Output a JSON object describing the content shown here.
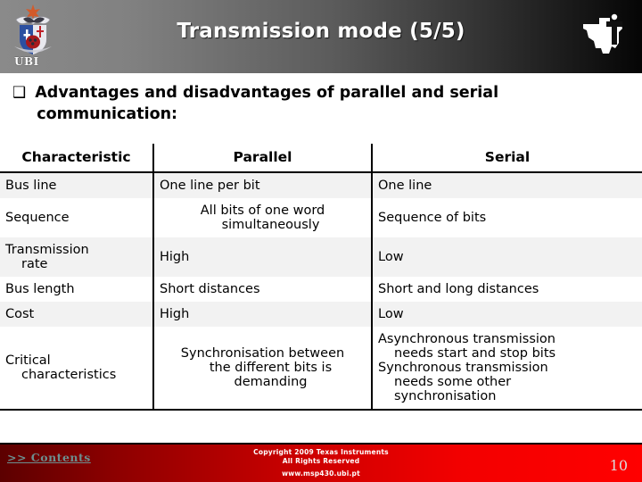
{
  "header": {
    "title": "Transmission mode (5/5)",
    "left_logo_label": "UBI",
    "right_logo_name": "ti-logo"
  },
  "bullet": {
    "glyph": "❑",
    "line1": "Advantages and disadvantages of parallel and serial",
    "line2": "communication:"
  },
  "table": {
    "columns": [
      "Characteristic",
      "Parallel",
      "Serial"
    ],
    "rows": [
      {
        "characteristic": "Bus line",
        "parallel": "One line per bit",
        "serial": "One line",
        "shaded": true
      },
      {
        "characteristic": "Sequence",
        "parallel_l1": "All bits of one word",
        "parallel_l2": "simultaneously",
        "serial": "Sequence of bits",
        "shaded": false
      },
      {
        "characteristic_l1": "Transmission",
        "characteristic_l2": "rate",
        "parallel": "High",
        "serial": "Low",
        "shaded": true
      },
      {
        "characteristic": "Bus length",
        "parallel": "Short distances",
        "serial": "Short and long distances",
        "shaded": false
      },
      {
        "characteristic": "Cost",
        "parallel": "High",
        "serial": "Low",
        "shaded": true
      },
      {
        "characteristic_l1": "Critical",
        "characteristic_l2": "characteristics",
        "parallel_l1": "Synchronisation between",
        "parallel_l2": "the different bits is",
        "parallel_l3": "demanding",
        "serial_l1": "Asynchronous transmission",
        "serial_l2": "needs start and stop bits",
        "serial_l3": "Synchronous transmission",
        "serial_l4": "needs some other",
        "serial_l5": "synchronisation",
        "shaded": false
      }
    ]
  },
  "footer": {
    "contents_link": ">> Contents",
    "copyright_line1": "Copyright  2009 Texas Instruments",
    "copyright_line2": "All Rights Reserved",
    "site_url": "www.msp430.ubi.pt",
    "page_number": "10"
  },
  "colors": {
    "header_gradient_start": "#8a8a8a",
    "header_gradient_end": "#050505",
    "footer_gradient_start": "#5c0000",
    "footer_gradient_end": "#ff0000",
    "row_shade": "#f2f2f2",
    "contents_link": "#6c8f8f",
    "page_number": "#dcdcdc"
  }
}
